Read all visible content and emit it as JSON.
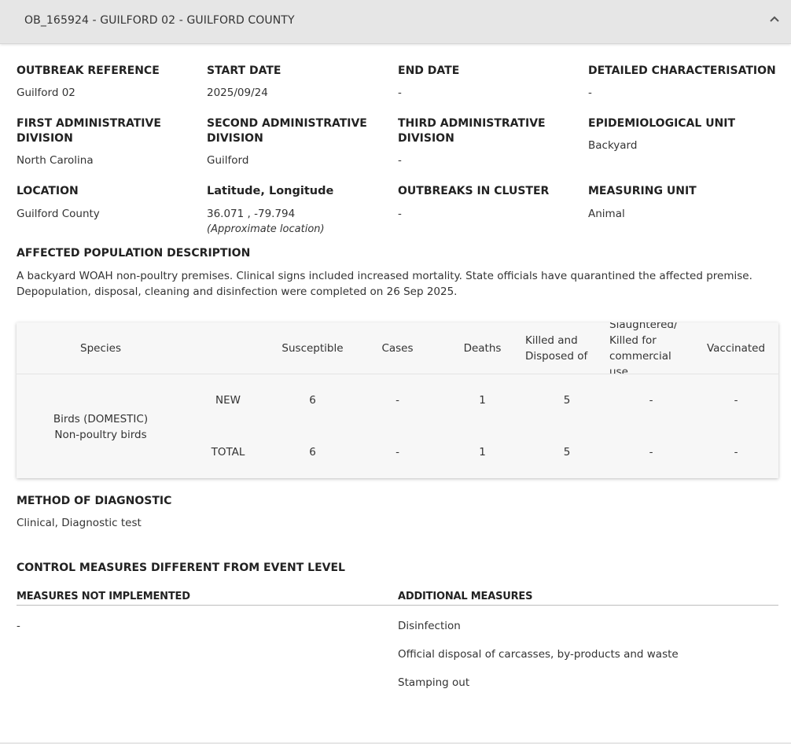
{
  "header": {
    "title": "OB_165924 - GUILFORD 02 - GUILFORD COUNTY",
    "chevron_icon": "chevron-up-icon"
  },
  "fields": {
    "outbreak_reference": {
      "label": "OUTBREAK REFERENCE",
      "value": "Guilford 02"
    },
    "start_date": {
      "label": "START DATE",
      "value": "2025/09/24"
    },
    "end_date": {
      "label": "END DATE",
      "value": "-"
    },
    "detailed_characterisation": {
      "label": "DETAILED CHARACTERISATION",
      "value": "-"
    },
    "first_admin_division": {
      "label_line1": "FIRST ADMINISTRATIVE",
      "label_line2": "DIVISION",
      "value": "North Carolina"
    },
    "second_admin_division": {
      "label_line1": "SECOND ADMINISTRATIVE",
      "label_line2": "DIVISION",
      "value": "Guilford"
    },
    "third_admin_division": {
      "label_line1": "THIRD ADMINISTRATIVE",
      "label_line2": "DIVISION",
      "value": "-"
    },
    "epidemiological_unit": {
      "label": "EPIDEMIOLOGICAL UNIT",
      "value": "Backyard"
    },
    "location": {
      "label": "LOCATION",
      "value": "Guilford County"
    },
    "lat_long": {
      "label": "Latitude, Longitude",
      "value": "36.071 , -79.794",
      "note": "(Approximate location)"
    },
    "outbreaks_in_cluster": {
      "label": "OUTBREAKS IN CLUSTER",
      "value": "-"
    },
    "measuring_unit": {
      "label": "MEASURING UNIT",
      "value": "Animal"
    }
  },
  "affected_population": {
    "label": "AFFECTED POPULATION DESCRIPTION",
    "text_line1": "A backyard WOAH non-poultry premises. Clinical signs included increased mortality. State officials have quarantined the affected premise.",
    "text_line2": "Depopulation, disposal, cleaning and disinfection were completed on 26 Sep 2025."
  },
  "table": {
    "headers": {
      "species": "Species",
      "susceptible": "Susceptible",
      "cases": "Cases",
      "deaths": "Deaths",
      "killed_line1": "Killed and",
      "killed_line2": "Disposed of",
      "slaughtered_line1": "Slaughtered/",
      "slaughtered_line2": "Killed for",
      "slaughtered_line3": "commercial",
      "slaughtered_line4": "use",
      "vaccinated": "Vaccinated"
    },
    "species_line1": "Birds (DOMESTIC)",
    "species_line2": "Non-poultry birds",
    "rows": [
      {
        "label": "NEW",
        "susceptible": "6",
        "cases": "-",
        "deaths": "1",
        "killed": "5",
        "slaughtered": "-",
        "vaccinated": "-"
      },
      {
        "label": "TOTAL",
        "susceptible": "6",
        "cases": "-",
        "deaths": "1",
        "killed": "5",
        "slaughtered": "-",
        "vaccinated": "-"
      }
    ]
  },
  "method_of_diagnostic": {
    "label": "METHOD OF DIAGNOSTIC",
    "value": "Clinical, Diagnostic test"
  },
  "control_measures": {
    "title": "CONTROL MEASURES DIFFERENT FROM EVENT LEVEL",
    "not_implemented_header": "MEASURES NOT IMPLEMENTED",
    "additional_header": "ADDITIONAL MEASURES",
    "not_implemented": [
      "-"
    ],
    "additional": [
      "Disinfection",
      "Official disposal of carcasses, by-products and waste",
      "Stamping out"
    ]
  }
}
